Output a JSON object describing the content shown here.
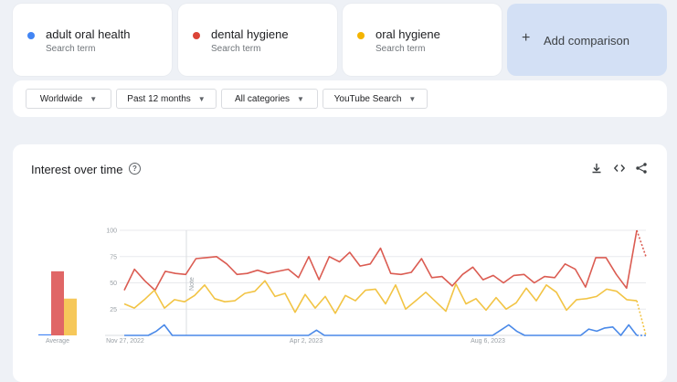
{
  "terms": [
    {
      "name": "adult oral health",
      "sub": "Search term",
      "color": "#4285f4"
    },
    {
      "name": "dental hygiene",
      "sub": "Search term",
      "color": "#db4437"
    },
    {
      "name": "oral hygiene",
      "sub": "Search term",
      "color": "#f4b400"
    }
  ],
  "add_comparison": {
    "label": "Add comparison",
    "icon": "plus-icon"
  },
  "filters": [
    {
      "label": "Worldwide"
    },
    {
      "label": "Past 12 months"
    },
    {
      "label": "All categories"
    },
    {
      "label": "YouTube Search"
    }
  ],
  "section": {
    "title": "Interest over time",
    "help_icon": "help-icon",
    "actions": [
      "download-icon",
      "embed-icon",
      "share-icon"
    ]
  },
  "chart_data": {
    "type": "line",
    "y_ticks": [
      100,
      75,
      50,
      25
    ],
    "ylim": [
      0,
      100
    ],
    "x_tick_labels": [
      "Nov 27, 2022",
      "Apr 2, 2023",
      "Aug 6, 2023"
    ],
    "note_label": "Note",
    "average_label": "Average",
    "averages": [
      {
        "name": "adult oral health",
        "value": 1,
        "color": "#4285f4"
      },
      {
        "name": "dental hygiene",
        "value": 61,
        "color": "#e06666"
      },
      {
        "name": "oral hygiene",
        "value": 35,
        "color": "#f6c85a"
      }
    ],
    "series": [
      {
        "name": "adult oral health",
        "color": "#4a89e8",
        "values": [
          0,
          0,
          0,
          0,
          4,
          10,
          0,
          0,
          0,
          0,
          0,
          0,
          0,
          0,
          0,
          0,
          0,
          0,
          0,
          0,
          0,
          0,
          0,
          0,
          5,
          0,
          0,
          0,
          0,
          0,
          0,
          0,
          0,
          0,
          0,
          0,
          0,
          0,
          0,
          0,
          0,
          0,
          0,
          0,
          0,
          0,
          0,
          5,
          10,
          4,
          0,
          0,
          0,
          0,
          0,
          0,
          0,
          0,
          6,
          4,
          7,
          8,
          0,
          10,
          0
        ],
        "partial_last": 0
      },
      {
        "name": "dental hygiene",
        "color": "#db5c52",
        "values": [
          43,
          63,
          52,
          43,
          61,
          59,
          58,
          73,
          74,
          75,
          68,
          58,
          59,
          62,
          59,
          61,
          63,
          55,
          75,
          53,
          75,
          70,
          79,
          66,
          68,
          83,
          59,
          58,
          60,
          73,
          55,
          56,
          47,
          58,
          65,
          53,
          57,
          50,
          57,
          58,
          50,
          56,
          55,
          68,
          63,
          46,
          74,
          74,
          58,
          45,
          100
        ],
        "partial_last": 75
      },
      {
        "name": "oral hygiene",
        "color": "#f2c445",
        "values": [
          30,
          26,
          34,
          43,
          26,
          34,
          32,
          38,
          48,
          35,
          32,
          33,
          40,
          42,
          52,
          37,
          40,
          22,
          39,
          26,
          37,
          21,
          38,
          33,
          43,
          44,
          30,
          48,
          25,
          33,
          41,
          32,
          23,
          49,
          30,
          35,
          24,
          36,
          25,
          31,
          45,
          33,
          48,
          41,
          24,
          34,
          35,
          37,
          44,
          42,
          34,
          33
        ],
        "partial_last": 0
      }
    ]
  }
}
